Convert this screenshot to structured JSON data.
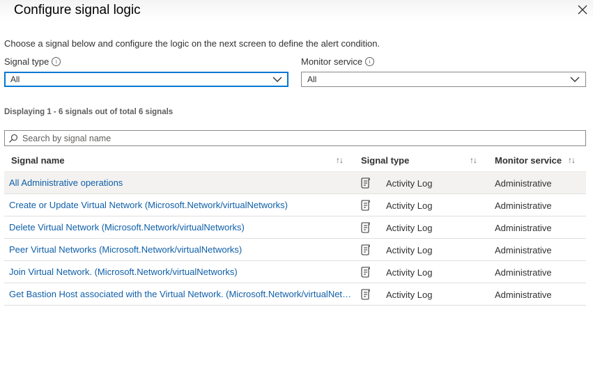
{
  "panel": {
    "title": "Configure signal logic",
    "description": "Choose a signal below and configure the logic on the next screen to define the alert condition."
  },
  "filters": {
    "signal_type": {
      "label": "Signal type",
      "value": "All"
    },
    "monitor_service": {
      "label": "Monitor service",
      "value": "All"
    }
  },
  "results": {
    "count_text": "Displaying 1 - 6 signals out of total 6 signals"
  },
  "search": {
    "placeholder": "Search by signal name"
  },
  "table": {
    "columns": [
      "Signal name",
      "Signal type",
      "Monitor service"
    ],
    "sort_glyph": "↑↓",
    "rows": [
      {
        "name": "All Administrative operations",
        "signal_type": "Activity Log",
        "monitor_service": "Administrative"
      },
      {
        "name": "Create or Update Virtual Network (Microsoft.Network/virtualNetworks)",
        "signal_type": "Activity Log",
        "monitor_service": "Administrative"
      },
      {
        "name": "Delete Virtual Network (Microsoft.Network/virtualNetworks)",
        "signal_type": "Activity Log",
        "monitor_service": "Administrative"
      },
      {
        "name": "Peer Virtual Networks (Microsoft.Network/virtualNetworks)",
        "signal_type": "Activity Log",
        "monitor_service": "Administrative"
      },
      {
        "name": "Join Virtual Network. (Microsoft.Network/virtualNetworks)",
        "signal_type": "Activity Log",
        "monitor_service": "Administrative"
      },
      {
        "name": "Get Bastion Host associated with the Virtual Network. (Microsoft.Network/virtualNetworks)",
        "signal_type": "Activity Log",
        "monitor_service": "Administrative"
      }
    ]
  },
  "colors": {
    "link": "#0f5fa8",
    "focus": "#0078d4",
    "selected_row": "#f3f2f1"
  },
  "icons": {
    "close": "close-icon",
    "info": "info-icon",
    "chevron": "chevron-down-icon",
    "search": "search-icon",
    "log": "log-icon"
  }
}
